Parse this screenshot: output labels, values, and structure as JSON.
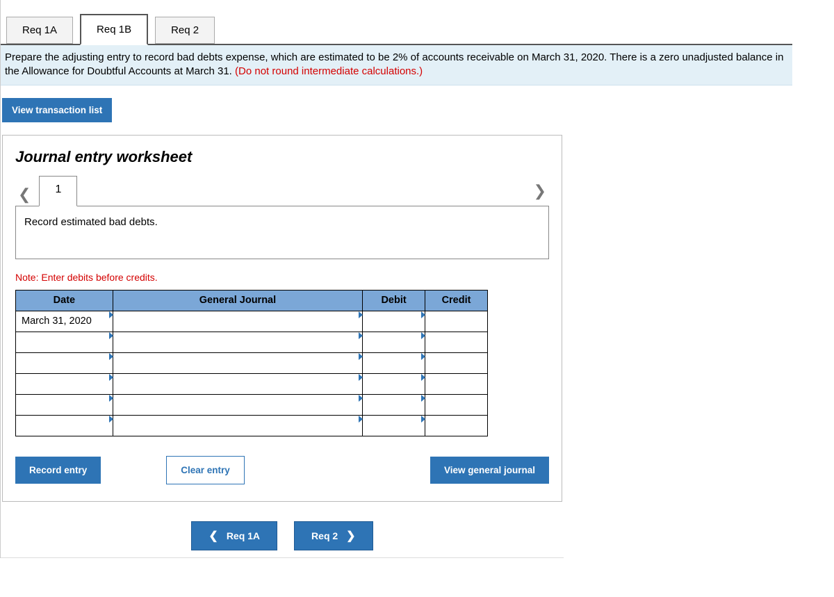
{
  "tabs": {
    "req1a": "Req 1A",
    "req1b": "Req 1B",
    "req2": "Req 2",
    "active": "req1b"
  },
  "instructions": {
    "text": "Prepare the adjusting entry to record bad debts expense, which are estimated to be 2% of accounts receivable on March 31, 2020. There is a zero unadjusted balance in the Allowance for Doubtful Accounts at March 31. ",
    "warning": "(Do not round intermediate calculations.)"
  },
  "buttons": {
    "view_transaction_list": "View transaction list",
    "record_entry": "Record entry",
    "clear_entry": "Clear entry",
    "view_general_journal": "View general journal"
  },
  "worksheet": {
    "title": "Journal entry worksheet",
    "page_number": "1",
    "record_instruction": "Record estimated bad debts.",
    "note": "Note: Enter debits before credits."
  },
  "table": {
    "headers": {
      "date": "Date",
      "general_journal": "General Journal",
      "debit": "Debit",
      "credit": "Credit"
    },
    "rows": [
      {
        "date": "March 31, 2020",
        "general_journal": "",
        "debit": "",
        "credit": ""
      },
      {
        "date": "",
        "general_journal": "",
        "debit": "",
        "credit": ""
      },
      {
        "date": "",
        "general_journal": "",
        "debit": "",
        "credit": ""
      },
      {
        "date": "",
        "general_journal": "",
        "debit": "",
        "credit": ""
      },
      {
        "date": "",
        "general_journal": "",
        "debit": "",
        "credit": ""
      },
      {
        "date": "",
        "general_journal": "",
        "debit": "",
        "credit": ""
      }
    ]
  },
  "bottom_nav": {
    "prev": "Req 1A",
    "next": "Req 2"
  }
}
